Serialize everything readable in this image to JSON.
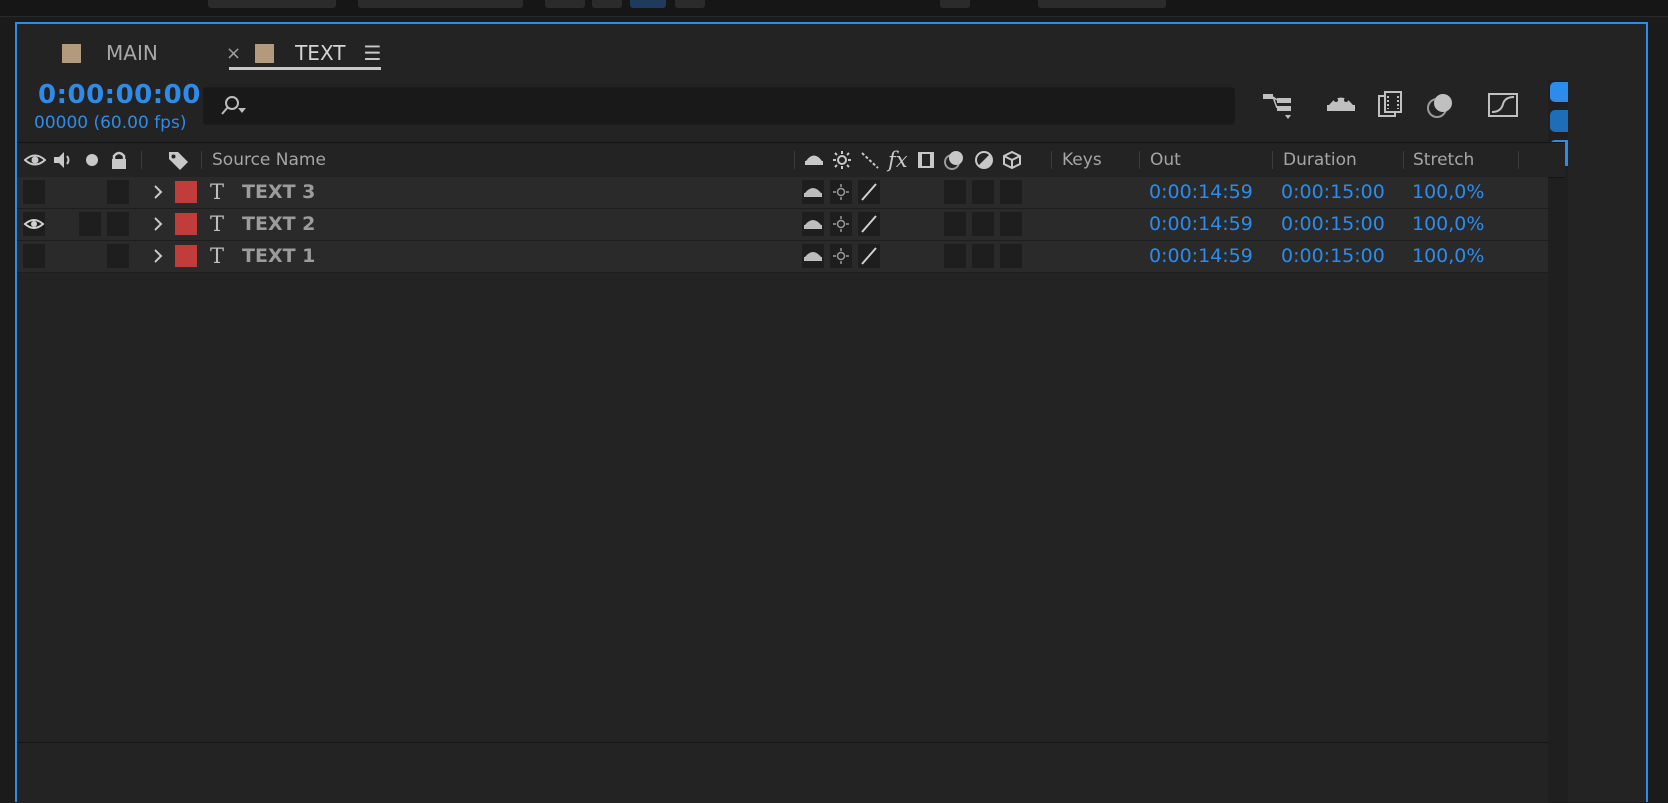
{
  "tabs": [
    {
      "label": "MAIN",
      "active": false
    },
    {
      "label": "TEXT",
      "active": true,
      "close": "×",
      "menu": "☰"
    }
  ],
  "timecode": "0:00:00:00",
  "frame_info": "00000 (60.00 fps)",
  "search": {
    "placeholder": "",
    "icon": "search-icon"
  },
  "columns": {
    "source_name": "Source Name",
    "keys": "Keys",
    "out": "Out",
    "duration": "Duration",
    "stretch": "Stretch"
  },
  "layers": [
    {
      "name": "TEXT 3",
      "type_glyph": "T",
      "visible": false,
      "out": "0:00:14:59",
      "duration": "0:00:15:00",
      "stretch": "100,0%",
      "label_color": "#c23c3c"
    },
    {
      "name": "TEXT 2",
      "type_glyph": "T",
      "visible": true,
      "out": "0:00:14:59",
      "duration": "0:00:15:00",
      "stretch": "100,0%",
      "label_color": "#c23c3c"
    },
    {
      "name": "TEXT 1",
      "type_glyph": "T",
      "visible": false,
      "out": "0:00:14:59",
      "duration": "0:00:15:00",
      "stretch": "100,0%",
      "label_color": "#c23c3c"
    }
  ],
  "colors": {
    "accent": "#2d8ceb",
    "panel": "#232323",
    "label_red": "#c23c3c",
    "comp_tan": "#b49a7c"
  }
}
